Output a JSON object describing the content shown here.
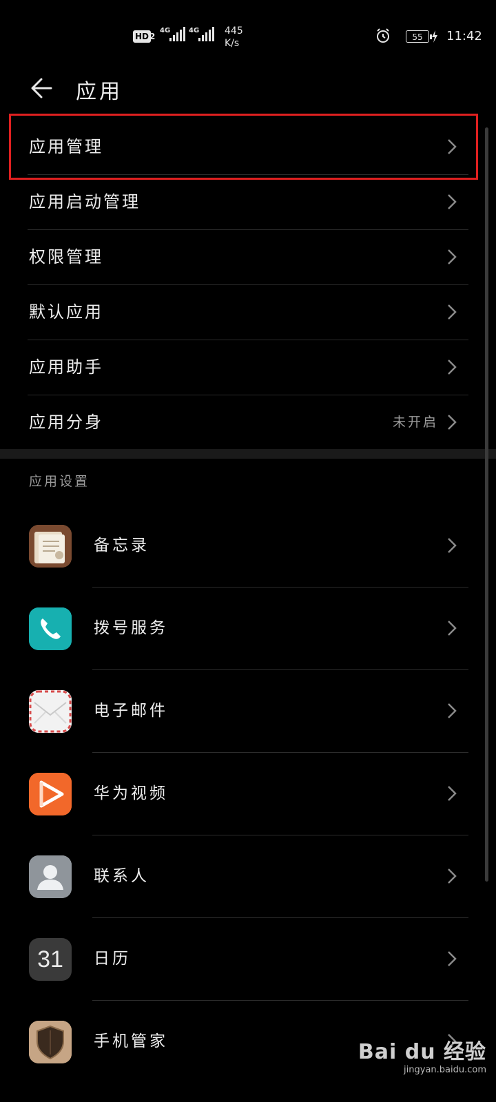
{
  "status_bar": {
    "hd_badge": "HD",
    "hd_sim": "2",
    "network_1": "4G",
    "network_2": "4G",
    "speed_value": "445",
    "speed_unit": "K/s",
    "battery": "55",
    "time": "11:42"
  },
  "header": {
    "back_icon": "arrow-left-icon",
    "title": "应用"
  },
  "menu": {
    "items": [
      {
        "label": "应用管理",
        "value": "",
        "highlighted": true
      },
      {
        "label": "应用启动管理",
        "value": ""
      },
      {
        "label": "权限管理",
        "value": ""
      },
      {
        "label": "默认应用",
        "value": ""
      },
      {
        "label": "应用助手",
        "value": ""
      },
      {
        "label": "应用分身",
        "value": "未开启"
      }
    ]
  },
  "app_settings": {
    "section_title": "应用设置",
    "apps": [
      {
        "label": "备忘录",
        "icon": "notepad-icon"
      },
      {
        "label": "拨号服务",
        "icon": "phone-icon"
      },
      {
        "label": "电子邮件",
        "icon": "mail-icon"
      },
      {
        "label": "华为视频",
        "icon": "video-icon"
      },
      {
        "label": "联系人",
        "icon": "contacts-icon"
      },
      {
        "label": "日历",
        "icon": "calendar-icon",
        "icon_text": "31"
      },
      {
        "label": "手机管家",
        "icon": "shield-icon"
      }
    ]
  },
  "watermark": {
    "brand": "Bai du 经验",
    "url": "jingyan.baidu.com"
  },
  "colors": {
    "background": "#000000",
    "highlight_border": "#e02020",
    "text_primary": "#ececec",
    "text_secondary": "#9a9a9a"
  }
}
